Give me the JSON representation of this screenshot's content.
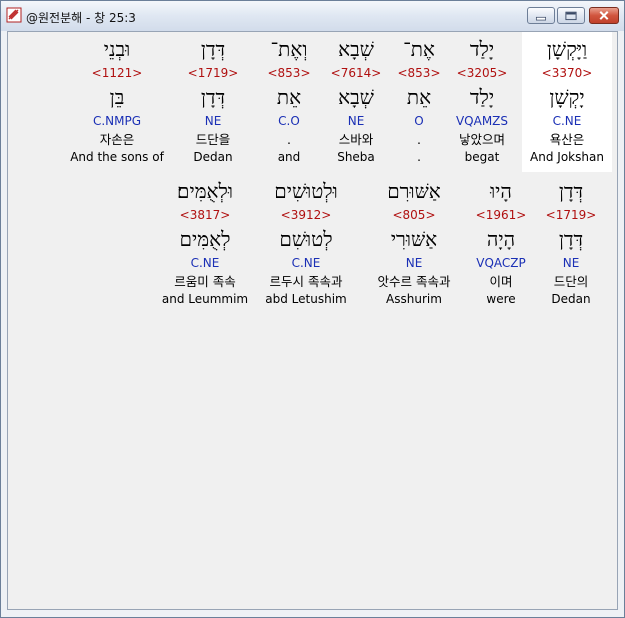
{
  "window": {
    "title": "@원전분해 - 창 25:3",
    "buttons": {
      "minimize": "minimize",
      "maximize": "maximize",
      "close": "close"
    }
  },
  "rows": [
    {
      "words": [
        {
          "heb": "וַיָּקְשָׁן",
          "strong": "<3370>",
          "lemma": "יָקְשָׁן",
          "morph": "C.NE",
          "kor": "욕산은",
          "eng": "And Jokshan",
          "highlight": true
        },
        {
          "heb": "יָלַד",
          "strong": "<3205>",
          "lemma": "יָלַד",
          "morph": "VQAMZS",
          "kor": "낳았으며",
          "eng": "begat"
        },
        {
          "heb": "אֶת־",
          "strong": "<853>",
          "lemma": "אֵת",
          "morph": "O",
          "kor": ".",
          "eng": "."
        },
        {
          "heb": "שְׁבָא",
          "strong": "<7614>",
          "lemma": "שְׁבָא",
          "morph": "NE",
          "kor": "스바와",
          "eng": "Sheba"
        },
        {
          "heb": "וְאֶת־",
          "strong": "<853>",
          "lemma": "אֵת",
          "morph": "C.O",
          "kor": ".",
          "eng": "and"
        },
        {
          "heb": "דְּדָן",
          "strong": "<1719>",
          "lemma": "דְּדָן",
          "morph": "NE",
          "kor": "드단을",
          "eng": "Dedan"
        },
        {
          "heb": "וּבְנֵי",
          "strong": "<1121>",
          "lemma": "בֵּן",
          "morph": "C.NMPG",
          "kor": "자손은",
          "eng": "And the sons of"
        }
      ]
    },
    {
      "words": [
        {
          "heb": "דְּדָן",
          "strong": "<1719>",
          "lemma": "דְּדָן",
          "morph": "NE",
          "kor": "드단의",
          "eng": "Dedan"
        },
        {
          "heb": "הָיוּ",
          "strong": "<1961>",
          "lemma": "הָיָה",
          "morph": "VQACZP",
          "kor": "이며",
          "eng": "were"
        },
        {
          "heb": "אַשּׁוּרִם",
          "strong": "<805>",
          "lemma": "אַשּׁוּרִי",
          "morph": "NE",
          "kor": "앗수르 족속과",
          "eng": "Asshurim"
        },
        {
          "heb": "וּלְטוּשִׁים",
          "strong": "<3912>",
          "lemma": "לְטוּשִׁם",
          "morph": "C.NE",
          "kor": "르두시 족속과",
          "eng": "abd Letushim"
        },
        {
          "heb": "וּלְאֻמִּים׃",
          "strong": "<3817>",
          "lemma": "לְאֻמִּים",
          "morph": "C.NE",
          "kor": "르움미 족속",
          "eng": "and Leummim"
        }
      ]
    }
  ]
}
